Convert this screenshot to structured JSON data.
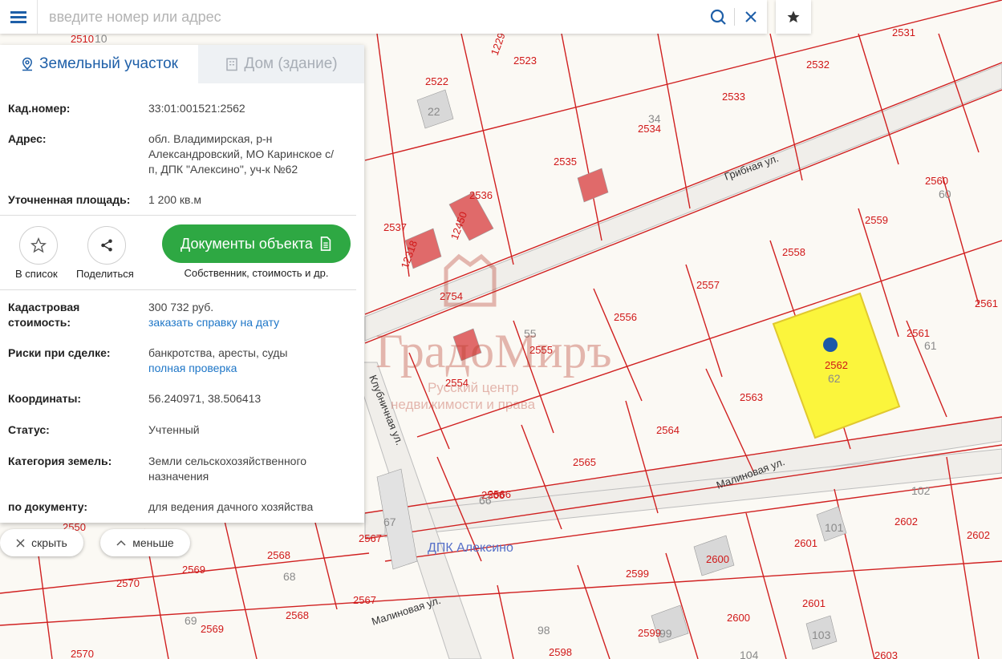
{
  "search": {
    "placeholder": "введите номер или адрес"
  },
  "panel": {
    "tabs": [
      {
        "label": "Земельный участок",
        "active": true
      },
      {
        "label": "Дом (здание)",
        "active": false
      }
    ],
    "cad_number": {
      "label": "Кад.номер:",
      "value": "33:01:001521:2562"
    },
    "address": {
      "label": "Адрес:",
      "lines": [
        "обл. Владимирская, р-н",
        "Александровский, МО Каринское с/",
        "п, ДПК \"Алексино\", уч-к №62"
      ]
    },
    "area": {
      "label": "Уточненная площадь:",
      "value": "1 200 кв.м"
    },
    "actions": {
      "add_to_list": "В список",
      "share": "Поделиться",
      "documents": "Документы объекта",
      "documents_sub": "Собственник, стоимость и др."
    },
    "cadastral_value": {
      "label_lines": [
        "Кадастровая",
        "стоимость:"
      ],
      "value": "300 732 руб.",
      "link": "заказать справку на дату"
    },
    "risks": {
      "label": "Риски при сделке:",
      "value": "банкротства, аресты, суды",
      "link": "полная проверка"
    },
    "coords": {
      "label": "Координаты:",
      "value": "56.240971, 38.506413"
    },
    "status": {
      "label": "Статус:",
      "value": "Учтенный"
    },
    "category": {
      "label": "Категория земель:",
      "lines": [
        "Земли сельскохозяйственного",
        "назначения"
      ]
    },
    "by_document": {
      "label": "по документу:",
      "value": "для ведения дачного хозяйства"
    }
  },
  "controls": {
    "hide": "скрыть",
    "less": "меньше"
  },
  "map": {
    "plots": [
      "2510",
      "2523",
      "2522",
      "2533",
      "2534",
      "2531",
      "2532",
      "2535",
      "2536",
      "2537",
      "2560",
      "2559",
      "2558",
      "2557",
      "2556",
      "2754",
      "2555",
      "2554",
      "2561",
      "2561",
      "2562",
      "2563",
      "2564",
      "2565",
      "2566",
      "2550",
      "2567",
      "2568",
      "2569",
      "2570",
      "2567",
      "2568",
      "2569",
      "2570",
      "2599",
      "2600",
      "2601",
      "2602",
      "2601",
      "2600",
      "2599",
      "2598",
      "2603",
      "2602",
      "2566",
      "12318",
      "12450",
      "12299"
    ],
    "houses": [
      "10",
      "22",
      "34",
      "60",
      "55",
      "61",
      "62",
      "102",
      "101",
      "67",
      "68",
      "69",
      "98",
      "99",
      "103",
      "104",
      "66"
    ],
    "streets": [
      "Грибная ул.",
      "Клубничная ул.",
      "Малиновая ул.",
      "Малиновая ул."
    ],
    "area_name": "ДПК Алексино",
    "watermark": {
      "brand": "ГрадоМиръ",
      "line1": "Русский центр",
      "line2": "недвижимости и права"
    }
  }
}
